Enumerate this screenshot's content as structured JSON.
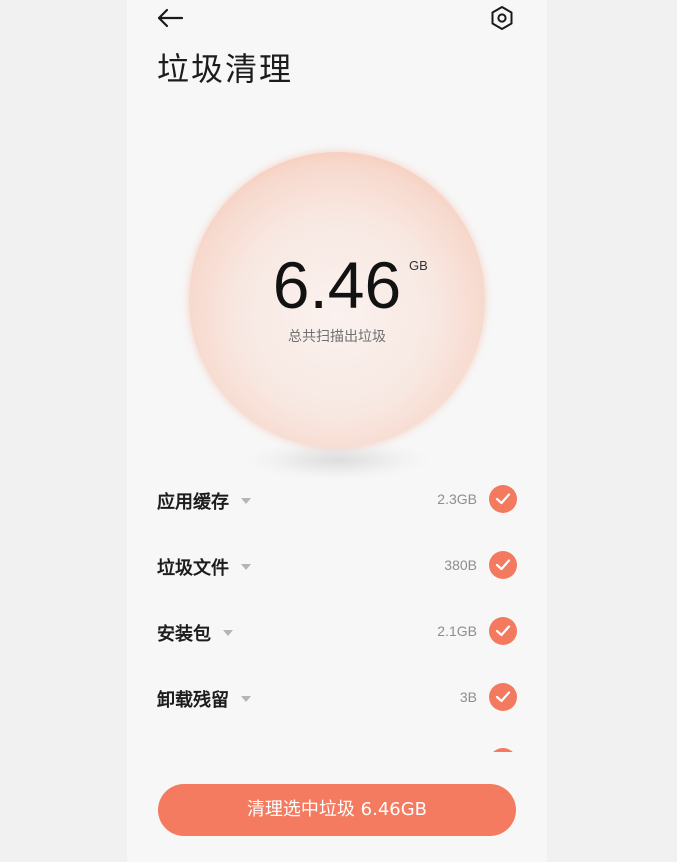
{
  "header": {
    "title": "垃圾清理",
    "back_icon": "arrow-left-icon",
    "settings_icon": "hexagon-settings-icon"
  },
  "summary": {
    "value": "6.46",
    "unit": "GB",
    "caption": "总共扫描出垃圾"
  },
  "items": [
    {
      "label": "应用缓存",
      "size": "2.3GB",
      "checked": true
    },
    {
      "label": "垃圾文件",
      "size": "380B",
      "checked": true
    },
    {
      "label": "安装包",
      "size": "2.1GB",
      "checked": true
    },
    {
      "label": "卸载残留",
      "size": "3B",
      "checked": true
    }
  ],
  "action": {
    "label": "清理选中垃圾 6.46GB"
  },
  "colors": {
    "accent": "#f47b60",
    "background": "#f7f7f7"
  }
}
